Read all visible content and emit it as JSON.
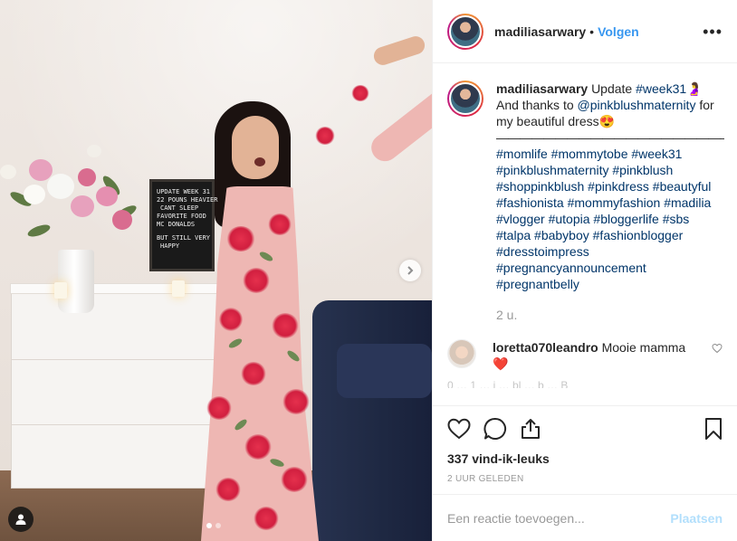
{
  "photo": {
    "letter_board": [
      "UPDATE WEEK 31",
      "22 POUNS HEAVIER",
      "CANT SLEEP",
      "FAVORITE FOOD",
      "MC DONALDS",
      "BUT STILL VERY",
      "HAPPY"
    ],
    "next_icon": "chevron-right-icon",
    "user_tag_icon": "user-icon",
    "carousel_index": 1,
    "carousel_count": 2
  },
  "header": {
    "username": "madiliasarwary",
    "separator": "•",
    "follow_label": "Volgen",
    "more_label": "•••"
  },
  "caption": {
    "username": "madiliasarwary",
    "text_1": "Update",
    "hashtag_week": "#week31",
    "emoji_1": "🤰",
    "line_2": "And thanks to",
    "mention": "@pinkblushmaternity",
    "line_2_end": "for",
    "line_3": "my beautiful dress",
    "emoji_2": "😍",
    "rule": "—————————————————————————————",
    "hashtags": "#momlife #mommytobe #week31 #pinkblushmaternity #pinkblush #shoppinkblush #pinkdress #beautyful #fashionista #mommyfashion #madilia #vlogger #utopia #bloggerlife #sbs #talpa #babyboy #fashionblogger #dresstoimpress #pregnancyannouncement #pregnantbelly",
    "time": "2 u."
  },
  "comments": [
    {
      "username": "loretta070leandro",
      "text": "Mooie mamma",
      "emoji": "❤️"
    }
  ],
  "partial_comment": "0 … 1 … i … bl … b … B",
  "actions": {
    "likes": "337 vind-ik-leuks",
    "posted": "2 UUR GELEDEN"
  },
  "add_comment": {
    "placeholder": "Een reactie toevoegen...",
    "post_label": "Plaatsen"
  },
  "colors": {
    "link": "#003569",
    "follow": "#3897f0",
    "muted": "#999999",
    "post_disabled": "#b2dffc"
  }
}
